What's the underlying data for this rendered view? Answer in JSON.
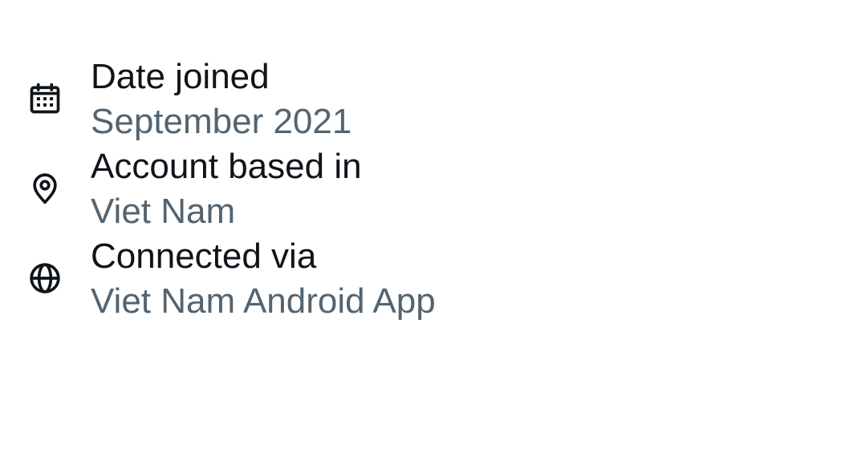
{
  "info": {
    "items": [
      {
        "icon": "calendar-icon",
        "label": "Date joined",
        "value": "September 2021"
      },
      {
        "icon": "location-pin-icon",
        "label": "Account based in",
        "value": "Viet Nam"
      },
      {
        "icon": "globe-icon",
        "label": "Connected via",
        "value": "Viet Nam Android App"
      }
    ]
  },
  "colors": {
    "label_text": "#0f1419",
    "value_text": "#536471",
    "icon": "#0f1419",
    "background": "#ffffff"
  }
}
